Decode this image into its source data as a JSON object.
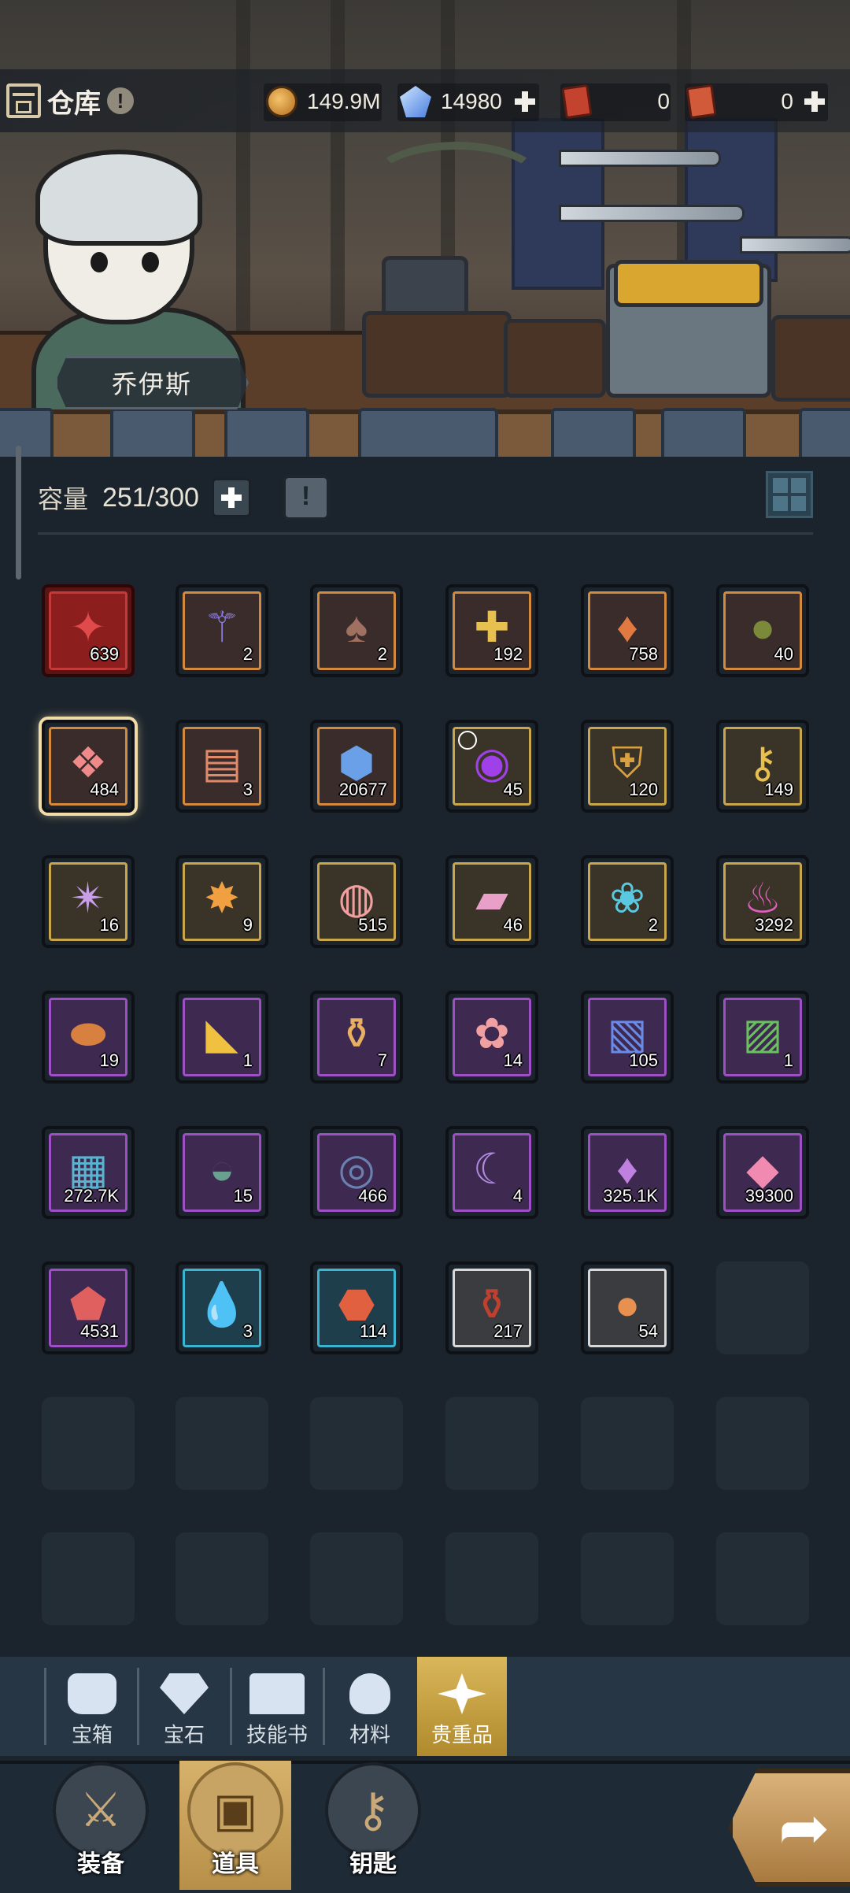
{
  "header": {
    "title": "仓库",
    "character_name": "乔伊斯",
    "currencies": {
      "gold": "149.9M",
      "diamonds": "14980",
      "ticket_a": "0",
      "ticket_b": "0"
    }
  },
  "capacity": {
    "label": "容量",
    "value": "251/300"
  },
  "items": [
    {
      "rarity": "red",
      "icon": "red-crystal-icon",
      "count": "639"
    },
    {
      "rarity": "orange",
      "icon": "magic-wand-icon",
      "count": "2"
    },
    {
      "rarity": "orange",
      "icon": "mushroom-icon",
      "count": "2"
    },
    {
      "rarity": "orange",
      "icon": "winged-cross-emblem-icon",
      "count": "192"
    },
    {
      "rarity": "orange",
      "icon": "orange-crystal-icon",
      "count": "758"
    },
    {
      "rarity": "orange",
      "icon": "acorn-pouch-icon",
      "count": "40"
    },
    {
      "rarity": "orange",
      "icon": "pink-crystal-cluster-icon",
      "count": "484",
      "selected": true
    },
    {
      "rarity": "orange",
      "icon": "scroll-banner-icon",
      "count": "3"
    },
    {
      "rarity": "orange",
      "icon": "paw-hexagon-icon",
      "count": "20677"
    },
    {
      "rarity": "gold",
      "icon": "purple-flame-spirit-icon",
      "count": "45",
      "timed": true
    },
    {
      "rarity": "gold",
      "icon": "sword-shield-emblem-icon",
      "count": "120"
    },
    {
      "rarity": "gold",
      "icon": "golden-key-icon",
      "count": "149"
    },
    {
      "rarity": "gold",
      "icon": "spiked-star-icon",
      "count": "16"
    },
    {
      "rarity": "gold",
      "icon": "orange-star-crystal-icon",
      "count": "9"
    },
    {
      "rarity": "gold",
      "icon": "bear-candy-icon",
      "count": "515"
    },
    {
      "rarity": "gold",
      "icon": "candy-roll-icon",
      "count": "46"
    },
    {
      "rarity": "gold",
      "icon": "blue-paw-icon",
      "count": "2"
    },
    {
      "rarity": "gold",
      "icon": "fire-essence-icon",
      "count": "3292"
    },
    {
      "rarity": "purple",
      "icon": "bread-icon",
      "count": "19"
    },
    {
      "rarity": "purple",
      "icon": "cheese-icon",
      "count": "1"
    },
    {
      "rarity": "purple",
      "icon": "potion-bottle-icon",
      "count": "7"
    },
    {
      "rarity": "purple",
      "icon": "paw-cookie-icon",
      "count": "14"
    },
    {
      "rarity": "purple",
      "icon": "blue-card-pack-icon",
      "count": "105"
    },
    {
      "rarity": "purple",
      "icon": "green-card-pack-icon",
      "count": "1"
    },
    {
      "rarity": "purple",
      "icon": "blue-map-icon",
      "count": "272.7K"
    },
    {
      "rarity": "purple",
      "icon": "stump-bowl-icon",
      "count": "15"
    },
    {
      "rarity": "purple",
      "icon": "stone-ring-icon",
      "count": "466"
    },
    {
      "rarity": "purple",
      "icon": "purple-claw-icon",
      "count": "4"
    },
    {
      "rarity": "purple",
      "icon": "purple-crystal-icon",
      "count": "325.1K"
    },
    {
      "rarity": "purple",
      "icon": "pink-gem-icon",
      "count": "39300"
    },
    {
      "rarity": "purple",
      "icon": "gem-shield-icon",
      "count": "4531"
    },
    {
      "rarity": "cyan",
      "icon": "water-drop-icon",
      "count": "3"
    },
    {
      "rarity": "cyan",
      "icon": "lava-rock-icon",
      "count": "114"
    },
    {
      "rarity": "white",
      "icon": "red-potion-icon",
      "count": "217"
    },
    {
      "rarity": "white",
      "icon": "cookie-icon",
      "count": "54"
    }
  ],
  "categories": [
    {
      "label": "宝箱",
      "icon": "chest-icon"
    },
    {
      "label": "宝石",
      "icon": "diamond-icon"
    },
    {
      "label": "技能书",
      "icon": "book-icon"
    },
    {
      "label": "材料",
      "icon": "ore-icon"
    },
    {
      "label": "贵重品",
      "icon": "sparkle-icon",
      "active": true
    }
  ],
  "bottom_nav": [
    {
      "label": "装备",
      "icon": "sword-armor-icon"
    },
    {
      "label": "道具",
      "icon": "backpack-icon",
      "active": true
    },
    {
      "label": "钥匙",
      "icon": "key-icon"
    }
  ],
  "colors": {
    "background": "#1b242c",
    "accent_gold": "#d7b26a",
    "rarity_red": "#c23a3a",
    "rarity_orange": "#d48a3c",
    "rarity_gold": "#c9a64a",
    "rarity_purple": "#9e4fc4",
    "rarity_cyan": "#3ab4d0",
    "rarity_white": "#d8d8d8"
  }
}
